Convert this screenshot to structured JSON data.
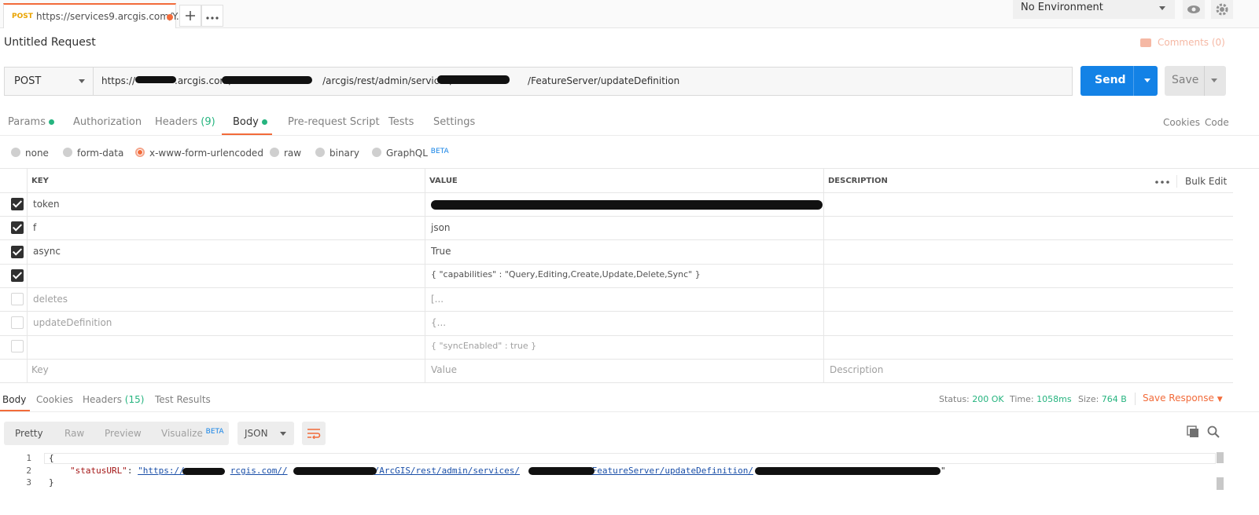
{
  "tab": {
    "method": "POST",
    "url": "https://services9.arcgis.com/Y..."
  },
  "env": {
    "selected": "No Environment"
  },
  "request": {
    "name": "Untitled Request",
    "comments": "Comments (0)",
    "method": "POST",
    "url_parts": [
      "https://",
      ".arcgis.com/",
      "/arcgis/rest/admin/services/",
      "/FeatureServer/updateDefinition"
    ]
  },
  "buttons": {
    "send": "Send",
    "save": "Save"
  },
  "request_tabs": [
    {
      "label": "Params"
    },
    {
      "label": "Authorization"
    },
    {
      "label": "Headers",
      "count": "(9)"
    },
    {
      "label": "Body"
    },
    {
      "label": "Pre-request Script"
    },
    {
      "label": "Tests"
    },
    {
      "label": "Settings"
    }
  ],
  "links": {
    "cookies": "Cookies",
    "code": "Code"
  },
  "body_types": [
    "none",
    "form-data",
    "x-www-form-urlencoded",
    "raw",
    "binary",
    "GraphQL"
  ],
  "beta": "BETA",
  "table": {
    "headers": {
      "key": "KEY",
      "value": "VALUE",
      "description": "DESCRIPTION"
    },
    "bulk_edit": "Bulk Edit",
    "rows": [
      {
        "checked": true,
        "key": "token",
        "value": ""
      },
      {
        "checked": true,
        "key": "f",
        "value": "json"
      },
      {
        "checked": true,
        "key": "async",
        "value": "True"
      },
      {
        "checked": true,
        "key": "",
        "value": "{ \"capabilities\" : \"Query,Editing,Create,Update,Delete,Sync\" }"
      },
      {
        "checked": false,
        "key": "deletes",
        "value": "[..."
      },
      {
        "checked": false,
        "key": "updateDefinition",
        "value": "{..."
      },
      {
        "checked": false,
        "key": "",
        "value": "{ \"syncEnabled\" : true }"
      }
    ],
    "placeholders": {
      "key": "Key",
      "value": "Value",
      "description": "Description"
    }
  },
  "response": {
    "tabs": [
      {
        "label": "Body"
      },
      {
        "label": "Cookies"
      },
      {
        "label": "Headers",
        "count": "(15)"
      },
      {
        "label": "Test Results"
      }
    ],
    "status_label": "Status:",
    "status": "200 OK",
    "time_label": "Time:",
    "time": "1058ms",
    "size_label": "Size:",
    "size": "764 B",
    "save_response": "Save Response",
    "views": [
      "Pretty",
      "Raw",
      "Preview",
      "Visualize"
    ],
    "format": "JSON",
    "lines": [
      "1",
      "2",
      "3"
    ],
    "code": {
      "open": "{",
      "key": "\"statusURL\"",
      "colon": ": ",
      "link_start": "\"https://",
      "link_mid1": "rcgis.com//",
      "link_mid2": "/ArcGIS/rest/admin/services/",
      "link_mid3": "/FeatureServer/updateDefinition/",
      "link_end": "\"",
      "close": "}"
    }
  },
  "colors": {
    "accent": "#f26b3a",
    "send": "#1382e6",
    "success": "#26b47f"
  }
}
